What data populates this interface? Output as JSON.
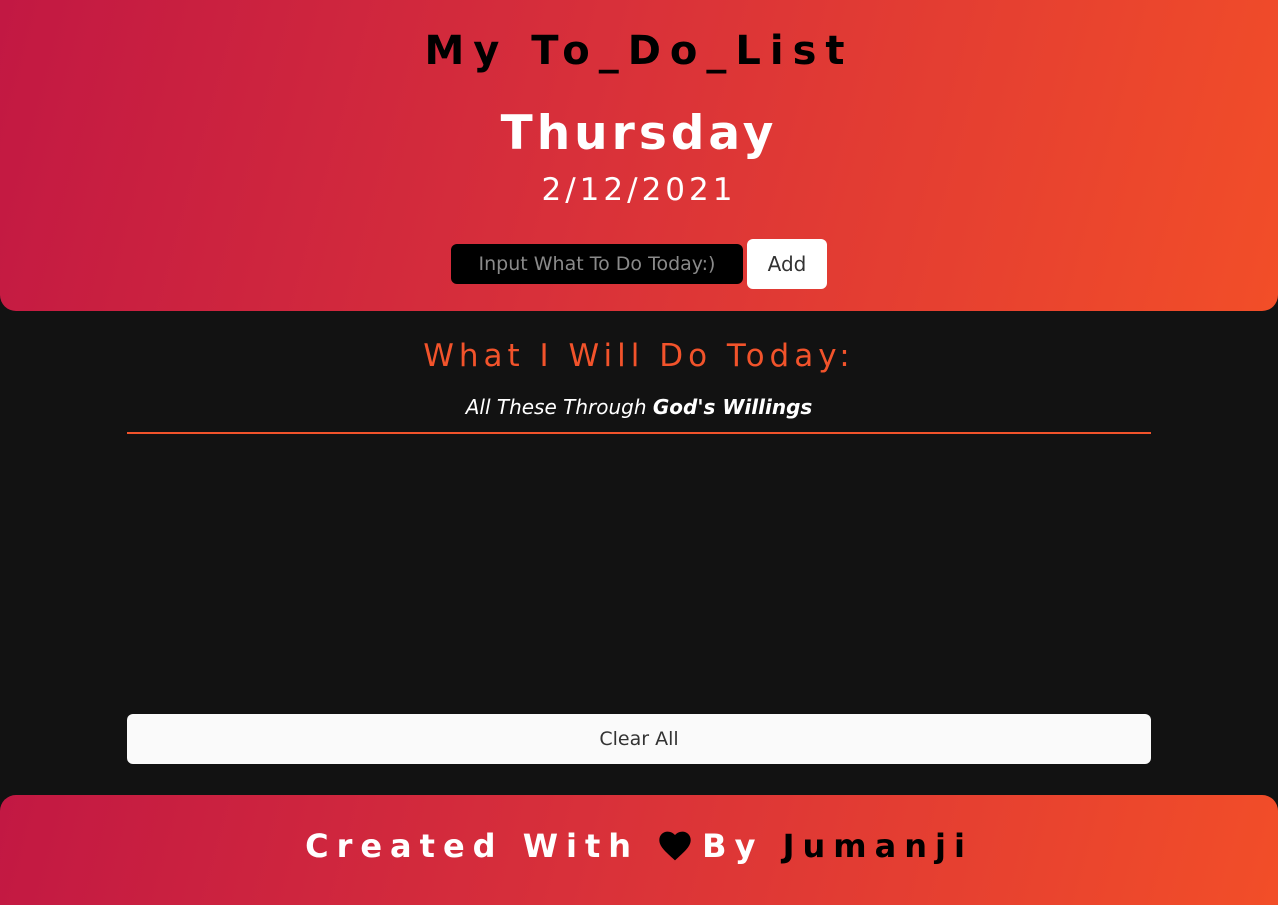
{
  "header": {
    "title": "My To_Do_List",
    "day": "Thursday",
    "date": "2/12/2021",
    "input_placeholder": "Input What To Do Today:)",
    "add_label": "Add"
  },
  "main": {
    "heading": "What I Will Do Today:",
    "subtitle_prefix": "All These Through ",
    "subtitle_emphasis": "God's Willings",
    "tasks": [],
    "clear_label": "Clear All"
  },
  "footer": {
    "prefix": "Created With ",
    "icon": "heart-icon",
    "by": "By ",
    "author": "Jumanji"
  },
  "colors": {
    "accent": "#f2532b",
    "gradient_start": "#c21843",
    "gradient_end": "#f24e28",
    "background": "#121212"
  }
}
